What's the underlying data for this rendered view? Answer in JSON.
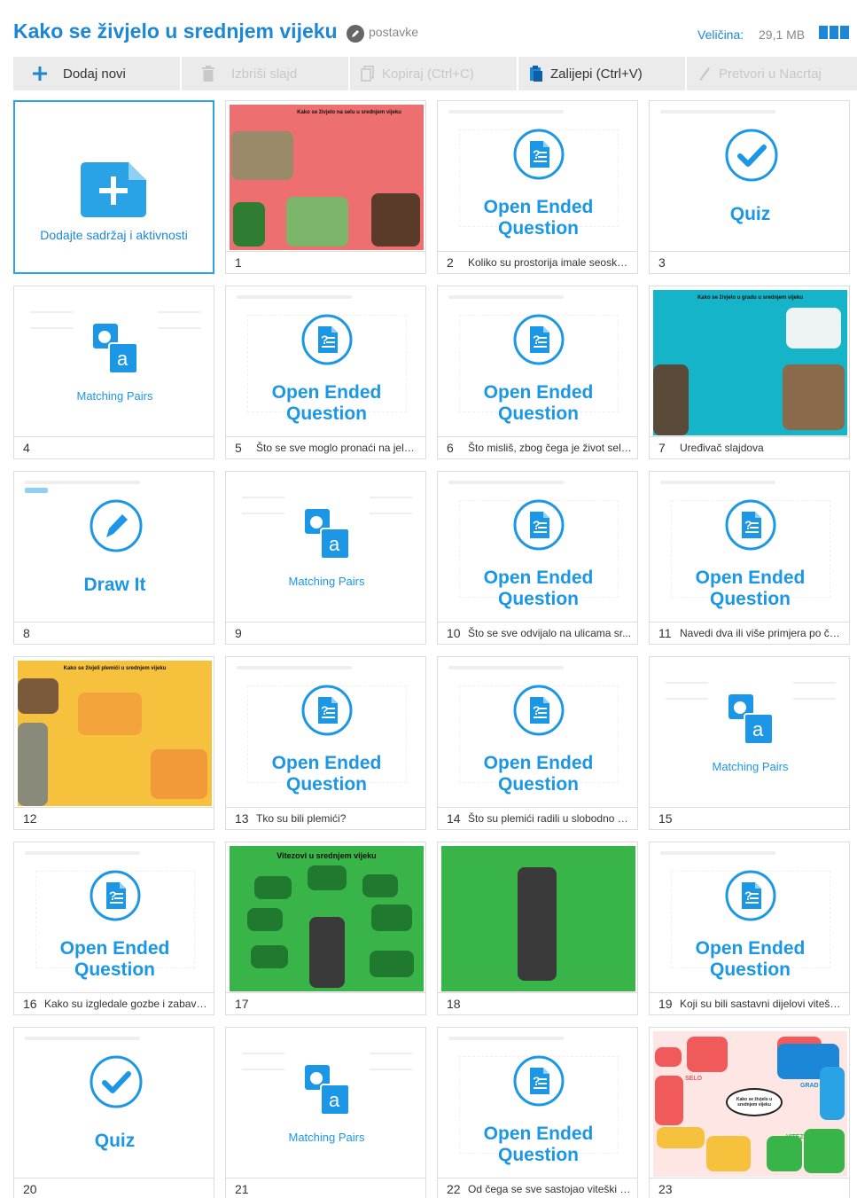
{
  "header": {
    "title": "Kako se živjelo u srednjem vijeku",
    "settings_label": "postavke",
    "size_label": "Veličina:",
    "size_value": "29,1 MB"
  },
  "toolbar": {
    "add_new": "Dodaj novi",
    "delete_slide": "Izbriši slajd",
    "copy": "Kopiraj (Ctrl+C)",
    "paste": "Zalijepi (Ctrl+V)",
    "convert": "Pretvori u Nacrtaj"
  },
  "add_card": {
    "label": "Dodajte sadržaj i aktivnosti"
  },
  "labels": {
    "open_ended": "Open Ended Question",
    "quiz": "Quiz",
    "matching": "Matching Pairs",
    "draw": "Draw It"
  },
  "slides": [
    {
      "num": "1",
      "type": "image",
      "theme": "red",
      "caption": ""
    },
    {
      "num": "2",
      "type": "open_ended",
      "caption": "Koliko su prostorija imale seoske ..."
    },
    {
      "num": "3",
      "type": "quiz",
      "caption": ""
    },
    {
      "num": "4",
      "type": "matching",
      "caption": ""
    },
    {
      "num": "5",
      "type": "open_ended",
      "caption": "Što se sve moglo pronaći na jelov..."
    },
    {
      "num": "6",
      "type": "open_ended",
      "caption": "Što misliš, zbog čega je život selj..."
    },
    {
      "num": "7",
      "type": "image",
      "theme": "teal",
      "caption": "Uređivač slajdova"
    },
    {
      "num": "8",
      "type": "draw",
      "caption": ""
    },
    {
      "num": "9",
      "type": "matching",
      "caption": ""
    },
    {
      "num": "10",
      "type": "open_ended",
      "caption": "Što se sve odvijalo na ulicama sr..."
    },
    {
      "num": "11",
      "type": "open_ended",
      "caption": "Navedi dva ili više primjera po če..."
    },
    {
      "num": "12",
      "type": "image",
      "theme": "yellow",
      "caption": ""
    },
    {
      "num": "13",
      "type": "open_ended",
      "caption": "Tko su bili plemići?"
    },
    {
      "num": "14",
      "type": "open_ended",
      "caption": "Što su plemići radili u slobodno vr..."
    },
    {
      "num": "15",
      "type": "matching",
      "caption": ""
    },
    {
      "num": "16",
      "type": "open_ended",
      "caption": "Kako su izgledale gozbe i zabave..."
    },
    {
      "num": "17",
      "type": "image",
      "theme": "green",
      "caption": ""
    },
    {
      "num": "18",
      "type": "image",
      "theme": "green2",
      "caption": ""
    },
    {
      "num": "19",
      "type": "open_ended",
      "caption": "Koji su bili sastavni dijelovi vitešk..."
    },
    {
      "num": "20",
      "type": "quiz",
      "caption": ""
    },
    {
      "num": "21",
      "type": "matching",
      "caption": ""
    },
    {
      "num": "22",
      "type": "open_ended",
      "caption": "Od čega se sve sastojao viteški o..."
    },
    {
      "num": "23",
      "type": "image",
      "theme": "pink",
      "caption": ""
    }
  ],
  "slide_texts": {
    "s1_title": "Kako se živjelo na selu u srednjem vijeku",
    "s7_title": "Kako se živjelo u gradu u srednjem vijeku",
    "s12_title": "Kako se živjeli plemići u srednjem vijeku",
    "s17_title": "Vitezovi u srednjem vijeku",
    "s23_center": "Kako se živjelo u srednjem vijeku",
    "s23_selo": "SELO",
    "s23_grad": "GRAD",
    "s23_plemici": "PLEMIĆI",
    "s23_vitezovi": "VITEZOVI"
  },
  "colors": {
    "accent": "#1b87d6",
    "icon_blue": "#1b97e6",
    "red_slide": "#ee6f6f",
    "teal_slide": "#16b4c9",
    "yellow_slide": "#f6c23e",
    "green_slide": "#38b449",
    "pink_slide": "#fde6e3"
  }
}
